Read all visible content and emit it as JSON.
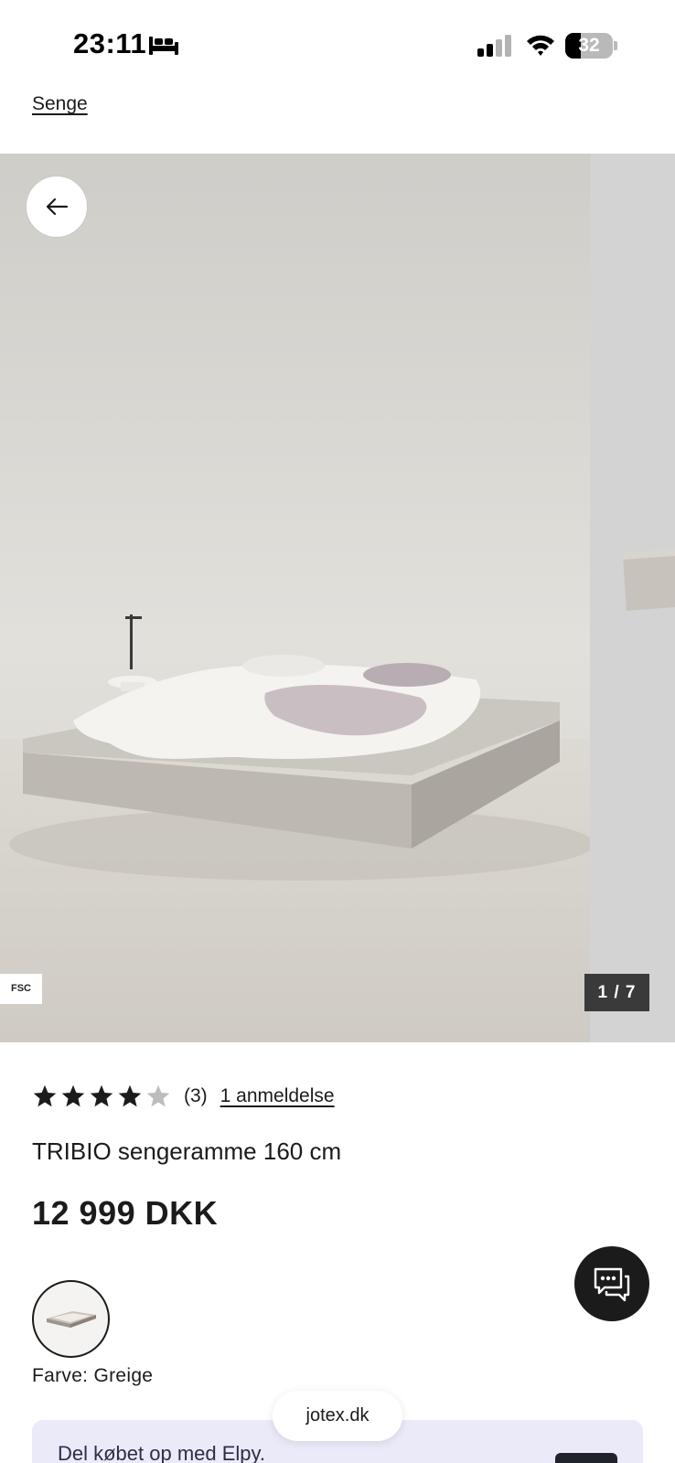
{
  "status_bar": {
    "time": "23:11",
    "battery_level": "32",
    "battery_fraction": 0.32
  },
  "breadcrumb": {
    "label": "Senge"
  },
  "gallery": {
    "fsc_label": "FSC",
    "counter": "1 / 7"
  },
  "product": {
    "rating": 4,
    "rating_max": 5,
    "rating_count": "(3)",
    "reviews_link": "1 anmeldelse",
    "title": "TRIBIO sengeramme 160 cm",
    "price": "12 999 DKK",
    "color_label": "Farve: Greige"
  },
  "browser": {
    "url": "jotex.dk"
  },
  "promo": {
    "text": "Del købet op med Elpy."
  },
  "colors": {
    "text": "#1b1b1b",
    "star_filled": "#1b1b1b",
    "star_empty": "#bdbdbd",
    "chat_button": "#1b1b1b",
    "promo_bg": "#ebeaf8"
  },
  "icons": {
    "back": "arrow-left-icon",
    "chat": "chat-bubbles-icon",
    "bed": "bed-icon",
    "signal": "signal-icon",
    "wifi": "wifi-icon",
    "battery": "battery-icon"
  }
}
